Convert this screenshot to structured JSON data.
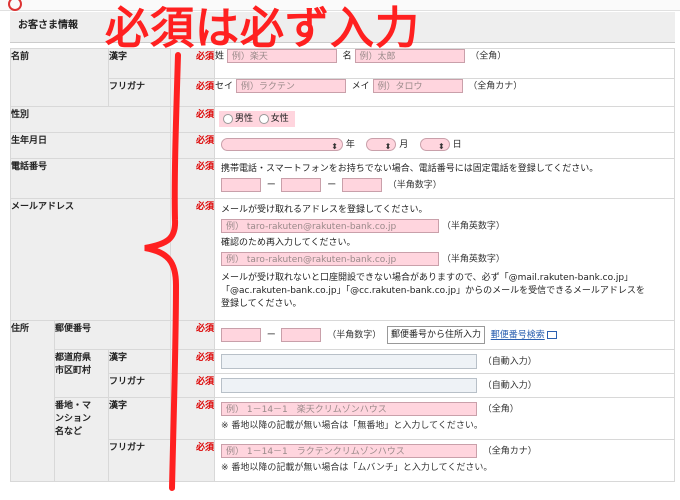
{
  "annotation": "必須は必ず入力",
  "section_title": "お客さま情報",
  "required_label": "必須",
  "name": {
    "label": "名前",
    "kanji_label": "漢字",
    "kana_label": "フリガナ",
    "sei_prefix": "姓",
    "sei_placeholder": "例）楽天",
    "mei_prefix": "名",
    "mei_placeholder": "例）太郎",
    "kanji_note": "（全角）",
    "kana_sei_prefix": "セイ",
    "kana_sei_placeholder": "例）ラクテン",
    "kana_mei_prefix": "メイ",
    "kana_mei_placeholder": "例）タロウ",
    "kana_note": "（全角カナ）"
  },
  "gender": {
    "label": "性別",
    "male": "男性",
    "female": "女性"
  },
  "birthday": {
    "label": "生年月日",
    "year": "年",
    "month": "月",
    "day": "日"
  },
  "phone": {
    "label": "電話番号",
    "help": "携帯電話・スマートフォンをお持ちでない場合、電話番号には固定電話を登録してください。",
    "dash": "ー",
    "note": "（半角数字）"
  },
  "email": {
    "label": "メールアドレス",
    "help": "メールが受け取れるアドレスを登録してください。",
    "placeholder": "例） taro-rakuten@rakuten-bank.co.jp",
    "note": "（半角英数字）",
    "confirm_help": "確認のため再入力してください。",
    "warn1": "メールが受け取れないと口座開設できない場合がありますので、必ず「@mail.rakuten-bank.co.jp」",
    "warn2": "「@ac.rakuten-bank.co.jp」「@cc.rakuten-bank.co.jp」からのメールを受信できるメールアドレスを",
    "warn3": "登録してください。"
  },
  "address": {
    "label": "住所",
    "postal_label": "郵便番号",
    "postal_dash": "ー",
    "postal_note": "（半角数字）",
    "postal_button": "郵便番号から住所入力",
    "postal_search": "郵便番号検索",
    "pref_label_1": "都道府県",
    "pref_label_2": "市区町村",
    "kanji_label": "漢字",
    "kana_label": "フリガナ",
    "auto_note": "（自動入力）",
    "block_label_1": "番地・マ",
    "block_label_2": "ンション",
    "block_label_3": "名など",
    "block_kanji_placeholder": "例） 1－14－1　楽天クリムゾンハウス",
    "block_kanji_note": "（全角）",
    "block_kanji_hint": "※ 番地以降の記載が無い場合は「無番地」と入力してください。",
    "block_kana_placeholder": "例） 1－14－1　ラクテンクリムゾンハウス",
    "block_kana_note": "（全角カナ）",
    "block_kana_hint": "※ 番地以降の記載が無い場合は「ムバンチ」と入力してください。"
  },
  "colors": {
    "required": "#dd0000",
    "input_pink": "#ffd5de",
    "label_bg": "#eeeeee",
    "annotation": "#ff2020",
    "link": "#2a5fb0"
  }
}
